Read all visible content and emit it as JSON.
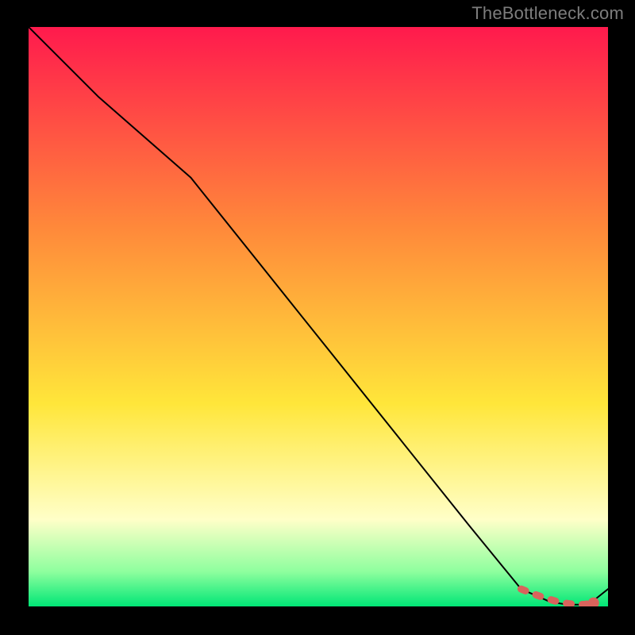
{
  "watermark": "TheBottleneck.com",
  "colors": {
    "bg_black": "#000000",
    "grad_top": "#ff1a4d",
    "grad_mid_upper": "#ff8a3a",
    "grad_mid": "#ffe63a",
    "grad_pale_yellow": "#ffffc8",
    "grad_green_soft": "#8eff9e",
    "grad_green": "#00e676",
    "line_black": "#000000",
    "marker_red": "#d9635c",
    "watermark_grey": "#7d7d7d"
  },
  "chart_data": {
    "type": "line",
    "title": "",
    "xlabel": "",
    "ylabel": "",
    "xlim": [
      0,
      100
    ],
    "ylim": [
      0,
      100
    ],
    "grid": false,
    "series": [
      {
        "name": "curve",
        "style": "solid-black",
        "x": [
          0,
          12,
          28,
          40,
          52,
          64,
          76,
          85,
          90,
          93,
          95,
          97,
          100
        ],
        "y": [
          100,
          88,
          74,
          59,
          44,
          29,
          14,
          3,
          0.8,
          0.3,
          0.3,
          0.6,
          3
        ]
      },
      {
        "name": "markers",
        "style": "dashed-red",
        "x": [
          85,
          87,
          89,
          91,
          93,
          94.5,
          96,
          97.5
        ],
        "y": [
          3,
          2.2,
          1.5,
          0.9,
          0.5,
          0.35,
          0.35,
          0.6
        ]
      }
    ],
    "annotations": [],
    "legend": null
  }
}
